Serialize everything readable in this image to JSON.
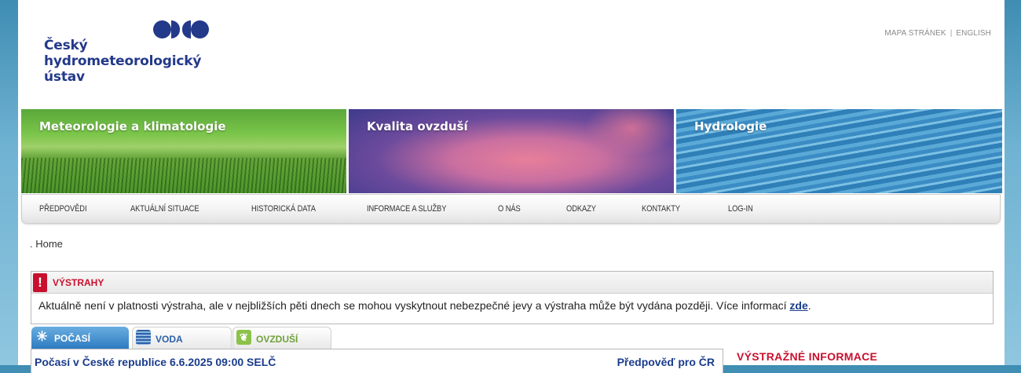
{
  "logo": {
    "line1": "Český",
    "line2": "hydrometeorologický",
    "line3": "ústav"
  },
  "toplinks": {
    "sitemap": "MAPA STRÁNEK",
    "separator": "|",
    "english": "ENGLISH"
  },
  "banners": [
    {
      "label": "Meteorologie a klimatologie"
    },
    {
      "label": "Kvalita ovzduší"
    },
    {
      "label": "Hydrologie"
    }
  ],
  "nav": {
    "items": [
      {
        "label": "PŘEDPOVĚDI"
      },
      {
        "label": "AKTUÁLNÍ SITUACE"
      },
      {
        "label": "HISTORICKÁ DATA"
      },
      {
        "label": "INFORMACE A SLUŽBY"
      },
      {
        "label": "O NÁS"
      },
      {
        "label": "ODKAZY"
      },
      {
        "label": "KONTAKTY"
      },
      {
        "label": "LOG-IN"
      }
    ]
  },
  "breadcrumb": ". Home",
  "warnings": {
    "icon": "!",
    "title": "VÝSTRAHY",
    "text": "Aktuálně není v platnosti výstraha, ale v nejbližších pěti dnech se mohou vyskytnout nebezpečné jevy a výstraha může být vydána později. Více informací ",
    "link": "zde",
    "tail": "."
  },
  "tabs": [
    {
      "label": "POČASÍ",
      "icon": "sun-icon",
      "glyph": "✳"
    },
    {
      "label": "VODA",
      "icon": "water-icon"
    },
    {
      "label": "OVZDUŠÍ",
      "icon": "leaf-icon",
      "glyph": "❦"
    }
  ],
  "weather": {
    "title": "Počasí v České republice 6.6.2025 09:00 SELČ",
    "forecast_link": "Předpověď pro ČR"
  },
  "sidebar": {
    "heading": "VÝSTRAŽNÉ INFORMACE"
  },
  "colors": {
    "brand": "#23398a",
    "warning_red": "#c8102e",
    "link_blue": "#1a3c8c"
  }
}
